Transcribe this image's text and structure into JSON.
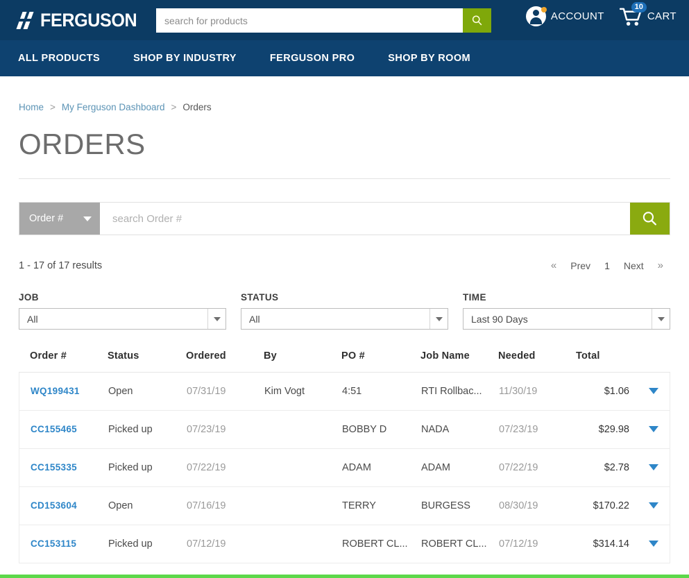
{
  "header": {
    "logo_text": "FERGUSON",
    "search_placeholder": "search for products",
    "search_value": "",
    "search_icon": "search-icon",
    "account_label": "ACCOUNT",
    "cart_label": "CART",
    "cart_count": "10",
    "brand_color": "#0c3b63",
    "accent_green": "#7fa80a"
  },
  "nav": {
    "items": [
      {
        "label": "ALL PRODUCTS"
      },
      {
        "label": "SHOP BY INDUSTRY"
      },
      {
        "label": "FERGUSON PRO"
      },
      {
        "label": "SHOP BY ROOM"
      }
    ]
  },
  "breadcrumb": {
    "items": [
      {
        "label": "Home",
        "link": true
      },
      {
        "label": "My Ferguson Dashboard",
        "link": true
      },
      {
        "label": "Orders",
        "link": false
      }
    ],
    "separator": ">"
  },
  "page": {
    "title": "ORDERS"
  },
  "order_search": {
    "select_value": "Order #",
    "input_placeholder": "search Order #",
    "input_value": "",
    "search_icon": "search-icon",
    "button_color": "#8aaa10"
  },
  "results": {
    "count_text": "1 - 17 of 17 results",
    "pager": {
      "first": "«",
      "prev": "Prev",
      "page": "1",
      "next": "Next",
      "last": "»"
    }
  },
  "filters": [
    {
      "label": "JOB",
      "value": "All"
    },
    {
      "label": "STATUS",
      "value": "All"
    },
    {
      "label": "TIME",
      "value": "Last 90 Days"
    }
  ],
  "table": {
    "columns": [
      "Order #",
      "Status",
      "Ordered",
      "By",
      "PO #",
      "Job Name",
      "Needed",
      "Total"
    ],
    "rows": [
      {
        "order": "WQ199431",
        "status": "Open",
        "ordered": "07/31/19",
        "by": "Kim Vogt",
        "po": "4:51",
        "job": "RTI Rollbac...",
        "needed": "11/30/19",
        "total": "$1.06"
      },
      {
        "order": "CC155465",
        "status": "Picked up",
        "ordered": "07/23/19",
        "by": "",
        "po": "BOBBY D",
        "job": "NADA",
        "needed": "07/23/19",
        "total": "$29.98"
      },
      {
        "order": "CC155335",
        "status": "Picked up",
        "ordered": "07/22/19",
        "by": "",
        "po": "ADAM",
        "job": "ADAM",
        "needed": "07/22/19",
        "total": "$2.78"
      },
      {
        "order": "CD153604",
        "status": "Open",
        "ordered": "07/16/19",
        "by": "",
        "po": "TERRY",
        "job": "BURGESS",
        "needed": "08/30/19",
        "total": "$170.22"
      },
      {
        "order": "CC153115",
        "status": "Picked up",
        "ordered": "07/12/19",
        "by": "",
        "po": "ROBERT CL...",
        "job": "ROBERT CL...",
        "needed": "07/12/19",
        "total": "$314.14"
      }
    ]
  },
  "progress": {
    "color": "#5cd84a"
  }
}
